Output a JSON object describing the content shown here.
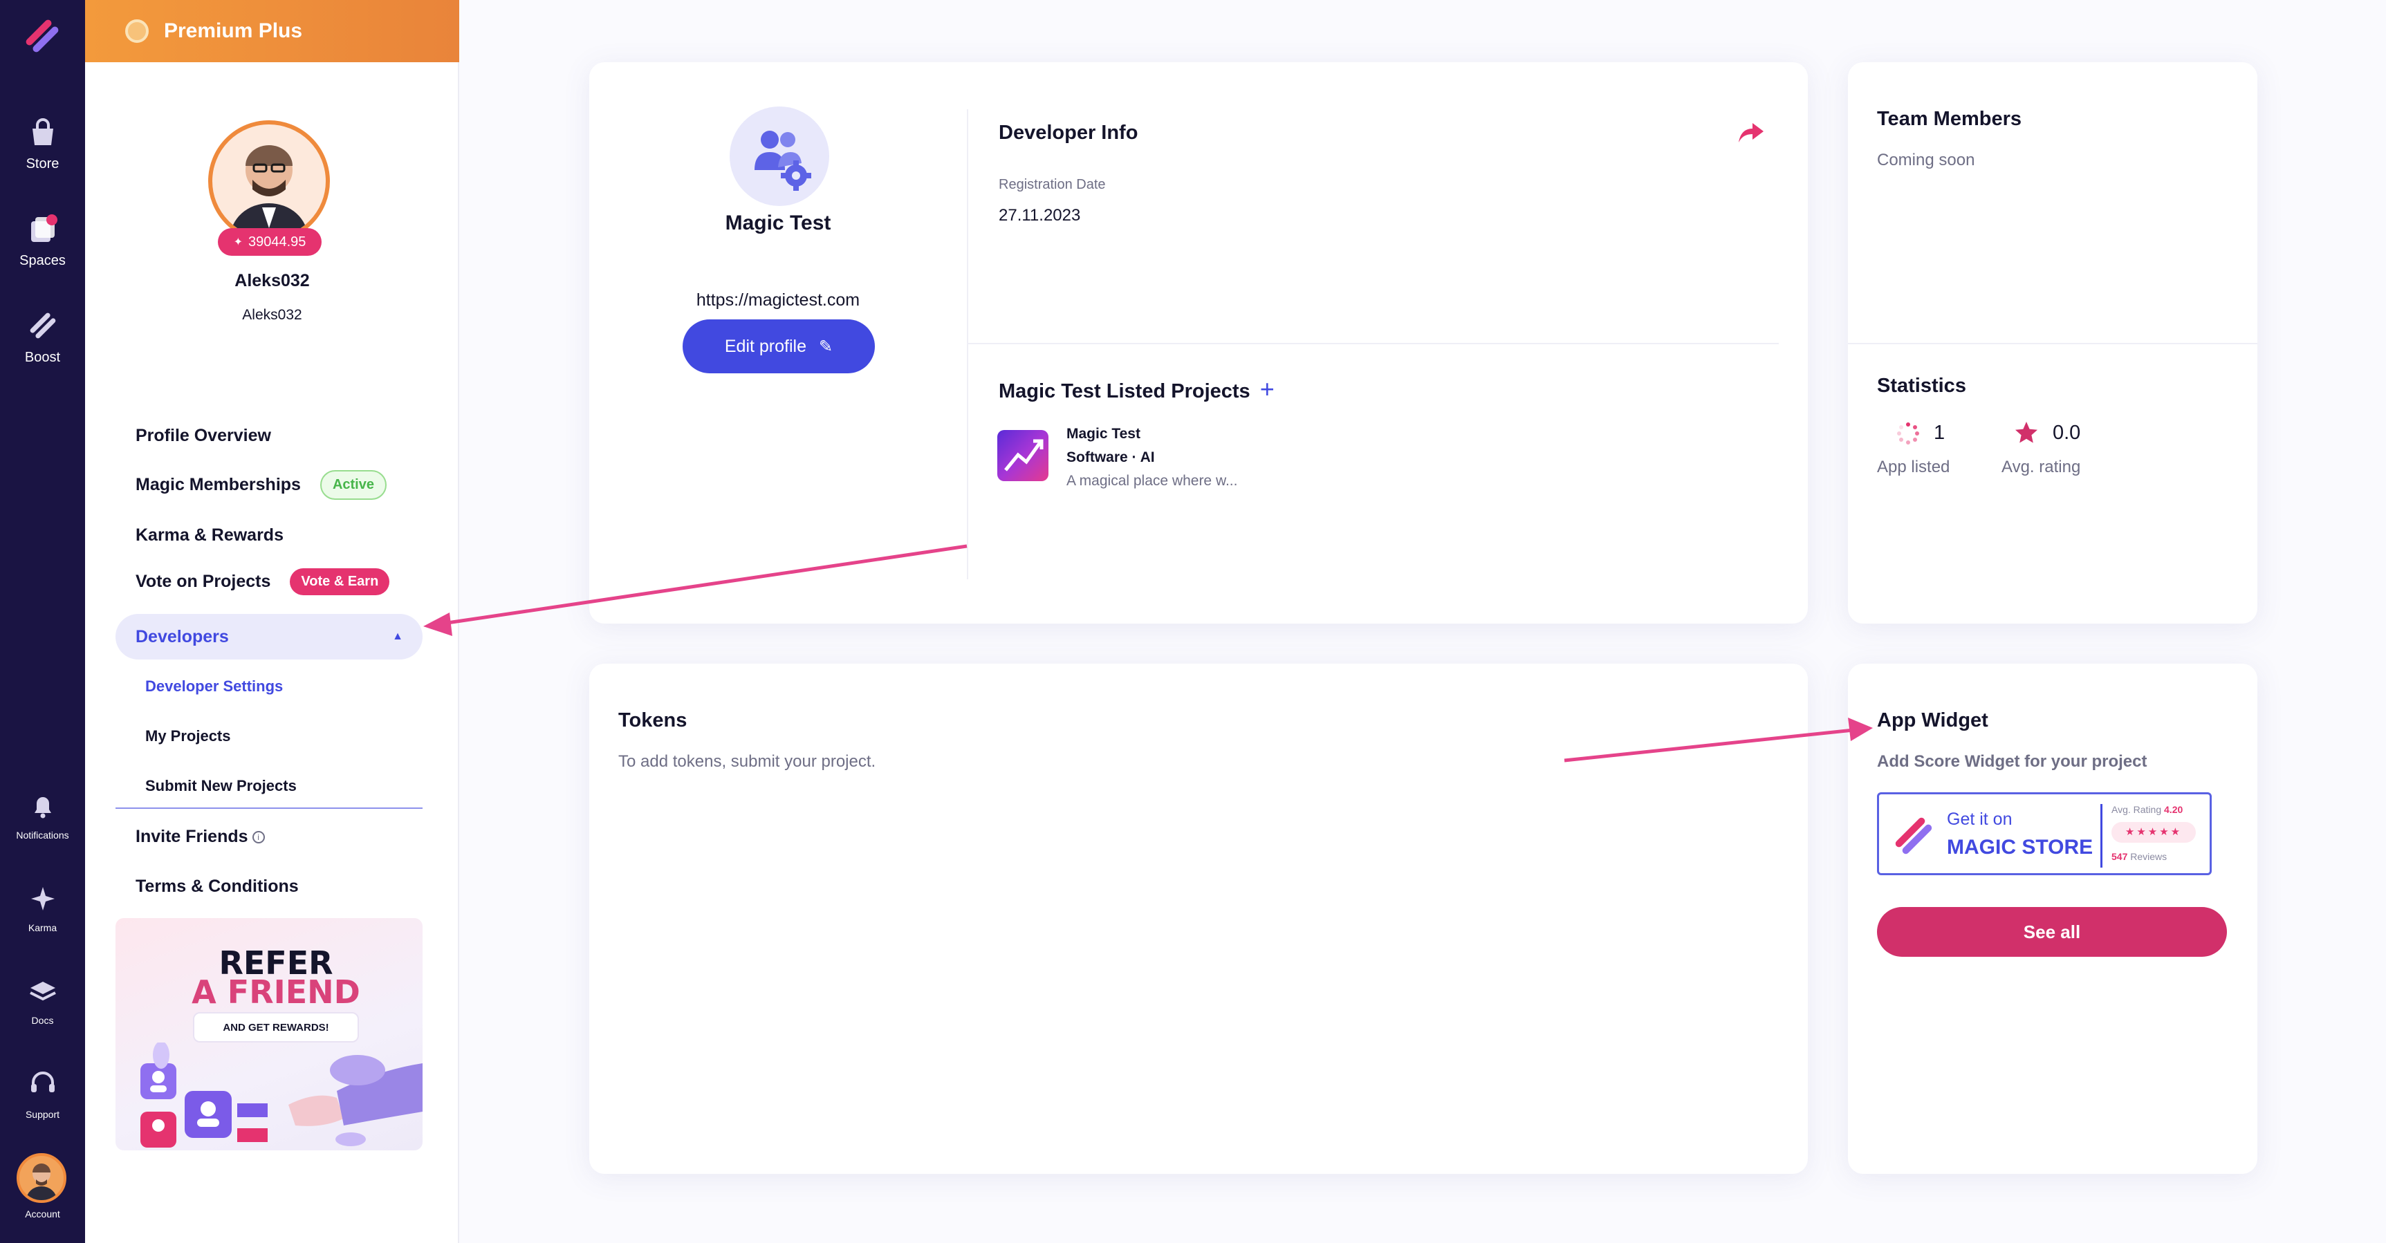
{
  "brand": {
    "accent": "#4149e0",
    "pink": "#e5336f",
    "rail_bg": "#1a1443",
    "premium": "#ef8a3c"
  },
  "rail": {
    "items": [
      {
        "label": "Store",
        "icon": "store-bag-icon"
      },
      {
        "label": "Spaces",
        "icon": "spaces-icon"
      },
      {
        "label": "Boost",
        "icon": "boost-icon"
      },
      {
        "label": "Notifications",
        "icon": "bell-icon"
      },
      {
        "label": "Karma",
        "icon": "sparkle-icon"
      },
      {
        "label": "Docs",
        "icon": "docs-stack-icon"
      },
      {
        "label": "Support",
        "icon": "headset-icon"
      },
      {
        "label": "Account",
        "icon": "avatar-icon"
      }
    ]
  },
  "sidebar": {
    "premium_label": "Premium Plus",
    "karma": "39044.95",
    "name": "Aleks032",
    "handle": "Aleks032",
    "nav": {
      "profile_overview": "Profile Overview",
      "memberships": "Magic Memberships",
      "memberships_badge": "Active",
      "karma_rewards": "Karma & Rewards",
      "vote": "Vote on Projects",
      "vote_badge": "Vote & Earn",
      "developers": "Developers",
      "developer_settings": "Developer Settings",
      "my_projects": "My Projects",
      "submit_projects": "Submit New Projects",
      "invite": "Invite Friends",
      "terms": "Terms & Conditions"
    },
    "refer": {
      "line1": "REFER",
      "line2": "A FRIEND",
      "sub": "AND GET REWARDS!"
    }
  },
  "developer": {
    "name": "Magic Test",
    "url": "https://magictest.com",
    "edit_label": "Edit profile",
    "info_title": "Developer Info",
    "reg_label": "Registration Date",
    "reg_date": "27.11.2023",
    "listed_title": "Magic Test Listed Projects",
    "project": {
      "name": "Magic Test",
      "category": "Software · AI",
      "description": "A magical place where w..."
    }
  },
  "team": {
    "title": "Team Members",
    "subtitle": "Coming soon"
  },
  "stats": {
    "title": "Statistics",
    "apps_listed_value": "1",
    "apps_listed_label": "App listed",
    "avg_rating_value": "0.0",
    "avg_rating_label": "Avg. rating"
  },
  "tokens": {
    "title": "Tokens",
    "subtitle": "To add tokens, submit your project."
  },
  "widget": {
    "title": "App Widget",
    "subtitle": "Add Score Widget for your project",
    "get_it_on": "Get it on",
    "store_name": "MAGIC STORE",
    "avg_rating_label": "Avg. Rating",
    "avg_rating_value": "4.20",
    "stars": "★★★★★",
    "reviews_count": "547",
    "reviews_label": "Reviews",
    "see_all": "See all"
  }
}
